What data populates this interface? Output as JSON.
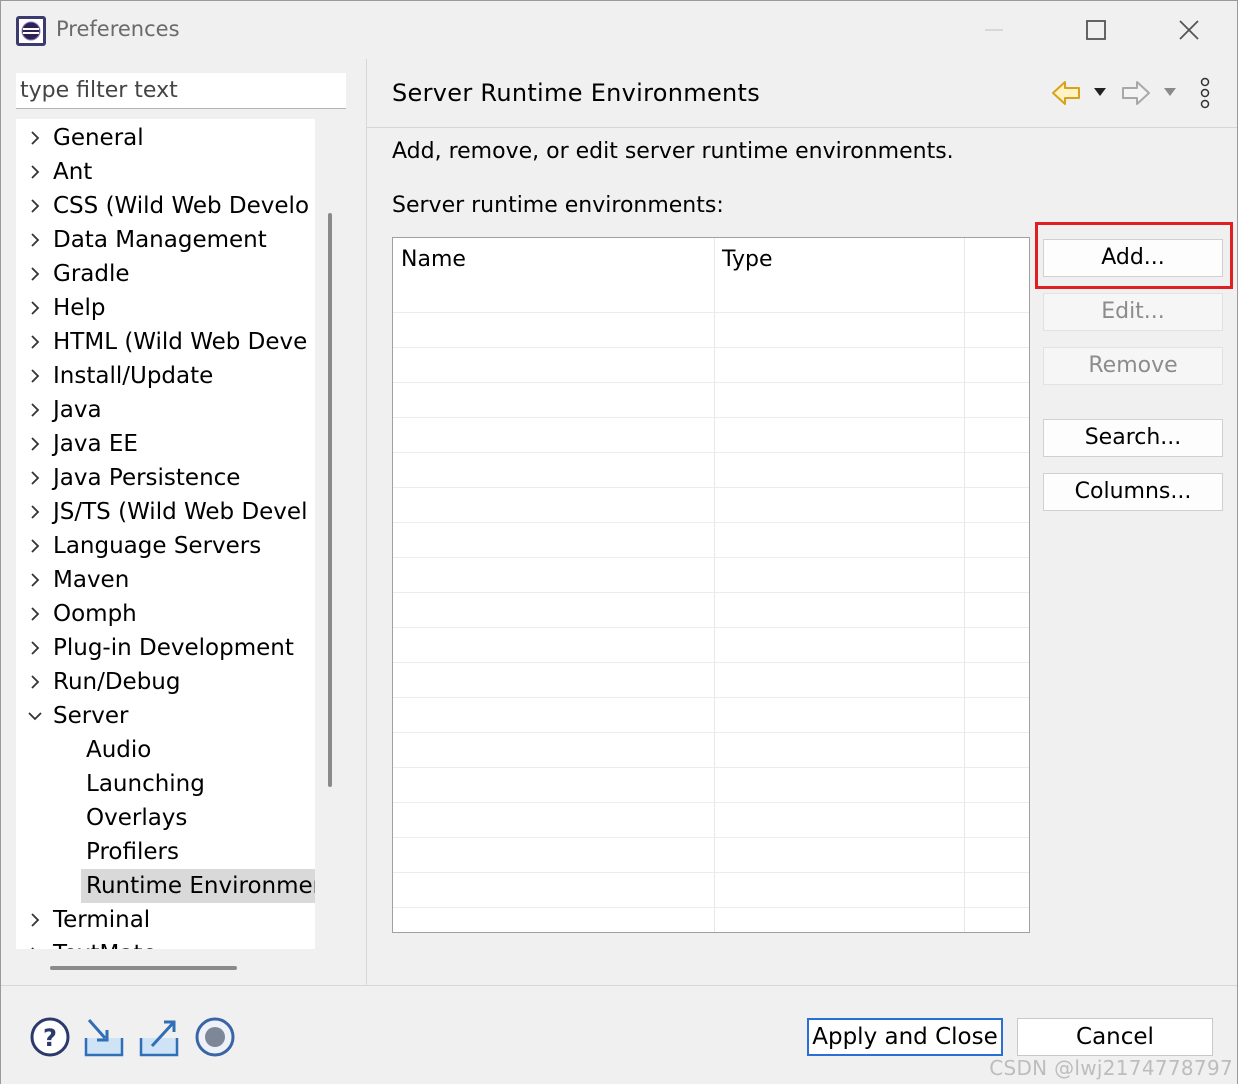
{
  "window": {
    "title": "Preferences"
  },
  "filter": {
    "placeholder": "type filter text"
  },
  "tree": {
    "items": [
      {
        "label": "General",
        "expanded": false
      },
      {
        "label": "Ant",
        "expanded": false
      },
      {
        "label": "CSS (Wild Web Develo",
        "expanded": false
      },
      {
        "label": "Data Management",
        "expanded": false
      },
      {
        "label": "Gradle",
        "expanded": false
      },
      {
        "label": "Help",
        "expanded": false
      },
      {
        "label": "HTML (Wild Web Deve",
        "expanded": false
      },
      {
        "label": "Install/Update",
        "expanded": false
      },
      {
        "label": "Java",
        "expanded": false
      },
      {
        "label": "Java EE",
        "expanded": false
      },
      {
        "label": "Java Persistence",
        "expanded": false
      },
      {
        "label": "JS/TS (Wild Web Devel",
        "expanded": false
      },
      {
        "label": "Language Servers",
        "expanded": false
      },
      {
        "label": "Maven",
        "expanded": false
      },
      {
        "label": "Oomph",
        "expanded": false
      },
      {
        "label": "Plug-in Development",
        "expanded": false
      },
      {
        "label": "Run/Debug",
        "expanded": false
      },
      {
        "label": "Server",
        "expanded": true
      },
      {
        "label": "Audio",
        "child": true
      },
      {
        "label": "Launching",
        "child": true
      },
      {
        "label": "Overlays",
        "child": true
      },
      {
        "label": "Profilers",
        "child": true
      },
      {
        "label": "Runtime Environmen",
        "child": true,
        "selected": true
      },
      {
        "label": "Terminal",
        "expanded": false
      },
      {
        "label": "TextMate",
        "expanded": false
      }
    ]
  },
  "page": {
    "title": "Server Runtime Environments",
    "description": "Add, remove, or edit server runtime environments.",
    "list_label": "Server runtime environments:",
    "columns": [
      "Name",
      "Type"
    ],
    "rows": []
  },
  "buttons": {
    "add": "Add...",
    "edit": "Edit...",
    "remove": "Remove",
    "search": "Search...",
    "columns": "Columns..."
  },
  "footer": {
    "apply_close": "Apply and Close",
    "cancel": "Cancel"
  },
  "watermark": "CSDN @lwj2174778797",
  "colors": {
    "highlight": "#e02020",
    "default_button_border": "#2a6fd6",
    "nav_back": "#e0a820"
  },
  "icons": {
    "app": "eclipse-icon",
    "back": "back-arrow-icon",
    "forward": "forward-arrow-icon",
    "menu": "more-vertical-icon",
    "help": "help-icon",
    "import": "import-icon",
    "export": "export-icon",
    "oomph": "record-icon"
  }
}
